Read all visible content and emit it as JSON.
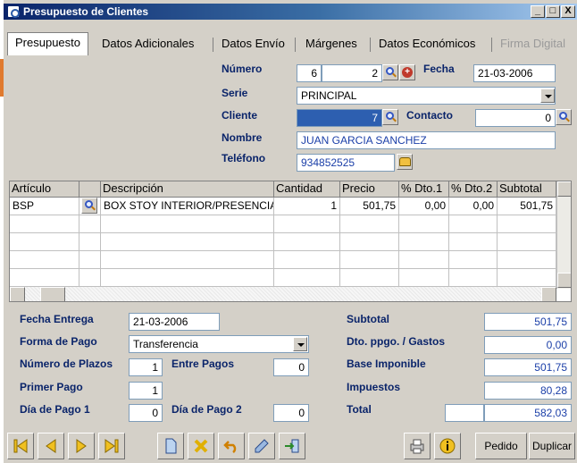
{
  "window": {
    "title": "Presupuesto de Clientes",
    "min": "_",
    "max": "□",
    "close": "X"
  },
  "tabs": [
    {
      "label": "Presupuesto",
      "active": true
    },
    {
      "label": "Datos Adicionales"
    },
    {
      "label": "Datos Envío"
    },
    {
      "label": "Márgenes"
    },
    {
      "label": "Datos Económicos"
    },
    {
      "label": "Firma Digital",
      "disabled": true
    }
  ],
  "header": {
    "numero_label": "Número",
    "numero_a": "6",
    "numero_b": "2",
    "fecha_label": "Fecha",
    "fecha": "21-03-2006",
    "serie_label": "Serie",
    "serie": "PRINCIPAL",
    "cliente_label": "Cliente",
    "cliente": "7",
    "contacto_label": "Contacto",
    "contacto": "0",
    "nombre_label": "Nombre",
    "nombre": "JUAN GARCIA SANCHEZ",
    "telefono_label": "Teléfono",
    "telefono": "934852525"
  },
  "grid": {
    "columns": [
      "Artículo",
      "",
      "Descripción",
      "Cantidad",
      "Precio",
      "% Dto.1",
      "% Dto.2",
      "Subtotal"
    ],
    "rows": [
      {
        "articulo": "BSP",
        "descripcion": "BOX STOY INTERIOR/PRESENCIA",
        "cantidad": "1",
        "precio": "501,75",
        "dto1": "0,00",
        "dto2": "0,00",
        "subtotal": "501,75"
      }
    ]
  },
  "footer": {
    "fecha_entrega_label": "Fecha Entrega",
    "fecha_entrega": "21-03-2006",
    "forma_pago_label": "Forma de Pago",
    "forma_pago": "Transferencia",
    "num_plazos_label": "Número de Plazos",
    "num_plazos": "1",
    "entre_pagos_label": "Entre Pagos",
    "entre_pagos": "0",
    "primer_pago_label": "Primer Pago",
    "primer_pago": "1",
    "dia_pago1_label": "Día de Pago 1",
    "dia_pago1": "0",
    "dia_pago2_label": "Día de Pago 2",
    "dia_pago2": "0",
    "subtotal_label": "Subtotal",
    "subtotal": "501,75",
    "dto_label": "Dto. ppgo. / Gastos",
    "dto": "0,00",
    "base_label": "Base Imponible",
    "base": "501,75",
    "impuestos_label": "Impuestos",
    "impuestos": "80,28",
    "total_label": "Total",
    "total": "582,03"
  },
  "toolbar": {
    "pedido_label": "Pedido",
    "duplicar_label": "Duplicar"
  },
  "colors": {
    "label": "#0a246a",
    "value_blue": "#1b3fa8",
    "title_bar": "#0a246a"
  }
}
